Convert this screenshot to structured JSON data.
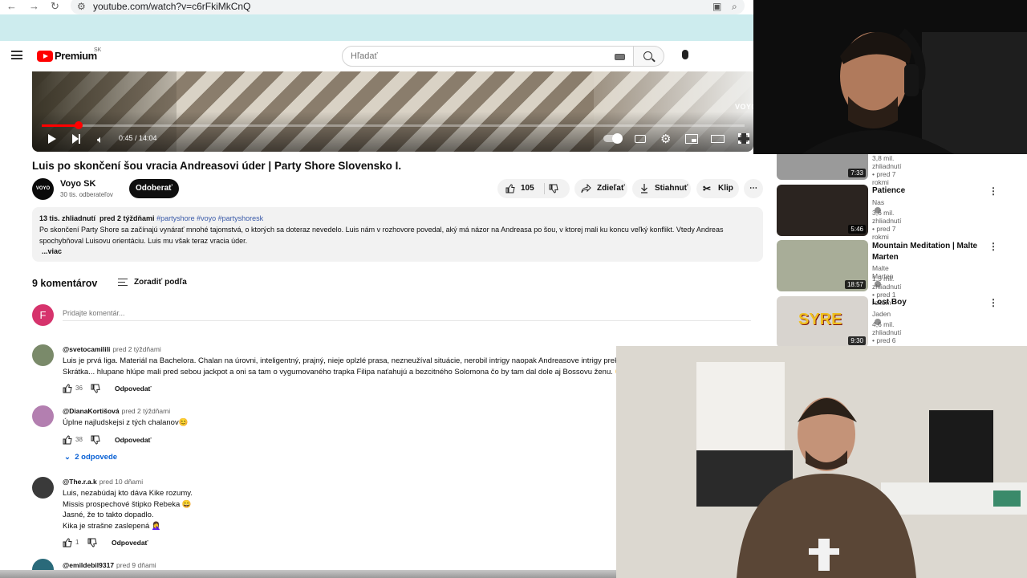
{
  "browser": {
    "url": "youtube.com/watch?v=c6rFkiMkCnQ"
  },
  "header": {
    "brand": "Premium",
    "region": "SK",
    "search_placeholder": "Hľadať"
  },
  "player": {
    "watermark": "VOYO",
    "time": "0:45 / 14:04",
    "progress_fraction": 0.053
  },
  "video": {
    "title": "Luis po skončení šou vracia Andreasovi úder | Party Shore Slovensko I.",
    "channel": {
      "avatar_text": "VOYO",
      "name": "Voyo SK",
      "subscribers": "30 tis. odberateľov"
    },
    "subscribe_label": "Odoberať",
    "likes": "105",
    "share_label": "Zdieľať",
    "download_label": "Stiahnuť",
    "clip_label": "Klip",
    "more_label": "⋯"
  },
  "description": {
    "views": "13 tis. zhliadnutí",
    "posted": "pred 2 týždňami",
    "tags": "#partyshore #voyo #partyshoresk",
    "text": "Po skončení Party Shore sa začínajú vynárať mnohé tajomstvá, o ktorých sa doteraz nevedelo. Luis nám v rozhovore povedal, aký má názor na Andreasa po šou, v ktorej mali ku koncu veľký konflikt. Vtedy Andreas spochybňoval Luisovu orientáciu. Luis mu však teraz vracia úder.",
    "more": "...viac"
  },
  "comments": {
    "count_label": "9 komentárov",
    "sort_label": "Zoradiť podľa",
    "user_initial": "F",
    "input_placeholder": "Pridajte komentár...",
    "reply_label": "Odpovedať",
    "items": [
      {
        "author": "@svetocamilili",
        "time": "pred 2 týždňami",
        "text": "Luis je prvá liga. Materiál na Bachelora. Chalan na úrovni, inteligentný, prajný, nieje oplzlé prasa, nezneužíval situácie, nerobil intrigy naopak Andreasove intrigy prekaz\nSkrátka... hlupane hlúpe mali pred sebou jackpot a oni sa tam o vygumovaného trapka Filipa naťahujú a bezcitného Solomona čo by tam dal dole aj Bossovu ženu. 😄",
        "likes": "36",
        "avatar_color": "#7a8a6a"
      },
      {
        "author": "@DianaKortišová",
        "time": "pred 2 týždňami",
        "text": "Úplne najludskejsi z tých chalanov😊",
        "likes": "38",
        "avatar_color": "#b37fb0"
      },
      {
        "author": "@The.r.a.k",
        "time": "pred 10 dňami",
        "text": "Luis, nezabúdaj kto dáva Kike rozumy.\nMissis prospechové štipko Rebeka 😀\nJasné,  že to takto dopadlo.\nKika je strašne zaslepená 🤦‍♀️",
        "likes": "1",
        "avatar_color": "#3a3a3a"
      },
      {
        "author": "@emildebil9317",
        "time": "pred 9 dňami",
        "avatar_color": "#2a6a7a"
      }
    ],
    "replies_label": "2 odpovede"
  },
  "recommendations": [
    {
      "title": "",
      "channel": "",
      "meta": "3,8 mil. zhliadnutí • pred 7 rokmi",
      "duration": "7:33",
      "thumb_color": "#9a9a9a"
    },
    {
      "title": "Patience",
      "channel": "Nas",
      "meta": "3,6 mil. zhliadnutí • pred 7 rokmi",
      "duration": "5:46",
      "thumb_color": "#2b2420"
    },
    {
      "title": "Mountain Meditation | Malte Marten",
      "channel": "Malte Marten",
      "meta": "1,5 mil. zhliadnutí • pred 1 rokom",
      "duration": "18:57",
      "thumb_color": "#a8ad98"
    },
    {
      "title": "Lost Boy",
      "channel": "Jaden",
      "meta": "4,6 mil. zhliadnutí • pred 6 rokmi",
      "duration": "9:30",
      "thumb_color": "#d8d4cf",
      "thumb_text": "SYRE"
    }
  ]
}
